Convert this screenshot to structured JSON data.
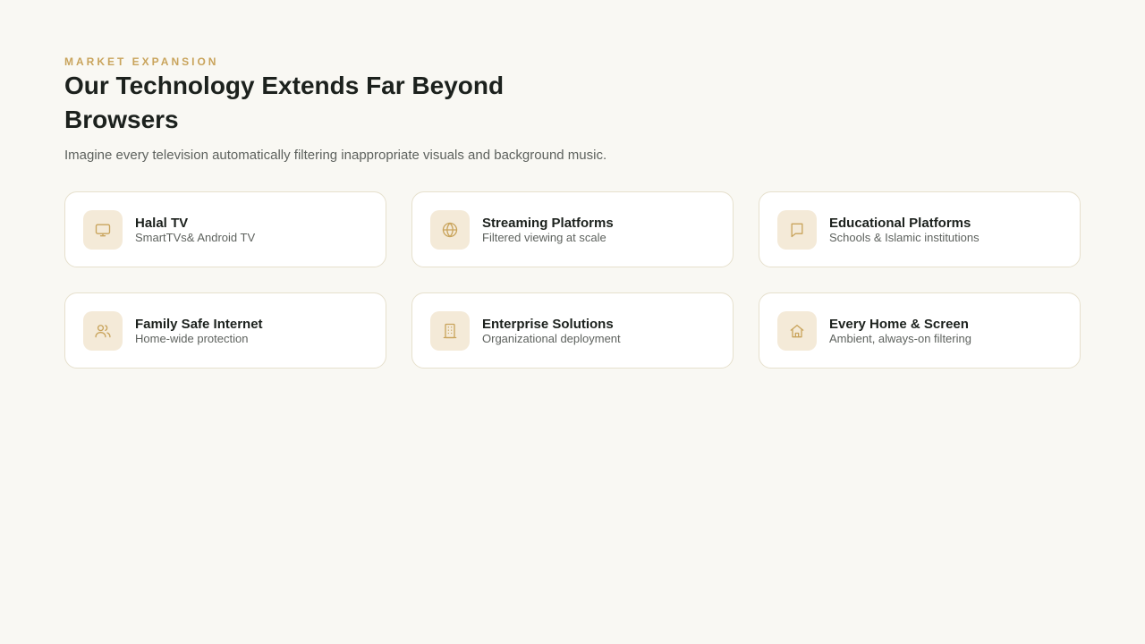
{
  "header": {
    "eyebrow": "MARKET EXPANSION",
    "title": "Our Technology Extends Far Beyond Browsers",
    "subtitle": "Imagine every television automatically filtering inappropriate visuals and background music."
  },
  "colors": {
    "background": "#f9f8f3",
    "accent": "#c9a45c",
    "icon_bg": "#f4ead8",
    "card_border": "#e6e0cd",
    "title_text": "#1c211d",
    "body_text": "#5e625e"
  },
  "cards": [
    {
      "icon": "tv-icon",
      "title": "Halal TV",
      "description": "SmartTVs& Android TV"
    },
    {
      "icon": "globe-icon",
      "title": "Streaming Platforms",
      "description": "Filtered viewing at scale"
    },
    {
      "icon": "book-icon",
      "title": "Educational Platforms",
      "description": "Schools & Islamic institutions"
    },
    {
      "icon": "users-icon",
      "title": "Family Safe Internet",
      "description": "Home-wide protection"
    },
    {
      "icon": "building-icon",
      "title": "Enterprise Solutions",
      "description": "Organizational deployment"
    },
    {
      "icon": "home-icon",
      "title": "Every Home & Screen",
      "description": "Ambient, always-on filtering"
    }
  ]
}
